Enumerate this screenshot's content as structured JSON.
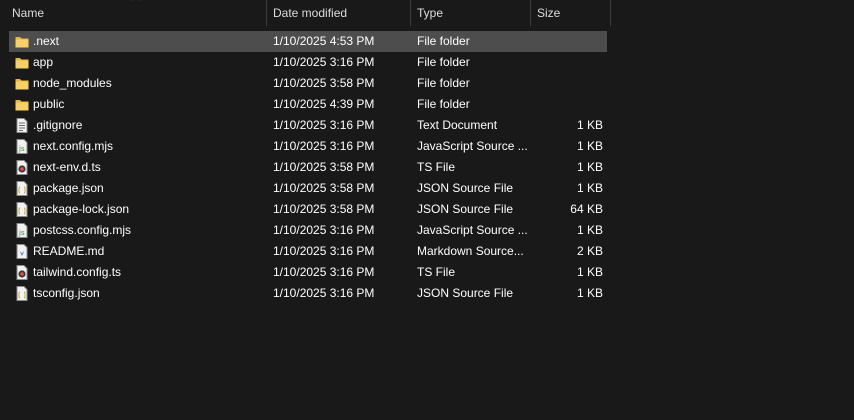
{
  "columns": {
    "name": "Name",
    "date": "Date modified",
    "type": "Type",
    "size": "Size"
  },
  "files": [
    {
      "name": ".next",
      "date": "1/10/2025 4:53 PM",
      "type": "File folder",
      "size": "",
      "icon": "folder-icon",
      "selected": true
    },
    {
      "name": "app",
      "date": "1/10/2025 3:16 PM",
      "type": "File folder",
      "size": "",
      "icon": "folder-icon",
      "selected": false
    },
    {
      "name": "node_modules",
      "date": "1/10/2025 3:58 PM",
      "type": "File folder",
      "size": "",
      "icon": "folder-icon",
      "selected": false
    },
    {
      "name": "public",
      "date": "1/10/2025 4:39 PM",
      "type": "File folder",
      "size": "",
      "icon": "folder-icon",
      "selected": false
    },
    {
      "name": ".gitignore",
      "date": "1/10/2025 3:16 PM",
      "type": "Text Document",
      "size": "1 KB",
      "icon": "text-document-icon",
      "selected": false
    },
    {
      "name": "next.config.mjs",
      "date": "1/10/2025 3:16 PM",
      "type": "JavaScript Source ...",
      "size": "1 KB",
      "icon": "javascript-file-icon",
      "selected": false
    },
    {
      "name": "next-env.d.ts",
      "date": "1/10/2025 3:58 PM",
      "type": "TS File",
      "size": "1 KB",
      "icon": "ts-file-icon",
      "selected": false
    },
    {
      "name": "package.json",
      "date": "1/10/2025 3:58 PM",
      "type": "JSON Source File",
      "size": "1 KB",
      "icon": "json-file-icon",
      "selected": false
    },
    {
      "name": "package-lock.json",
      "date": "1/10/2025 3:58 PM",
      "type": "JSON Source File",
      "size": "64 KB",
      "icon": "json-file-icon",
      "selected": false
    },
    {
      "name": "postcss.config.mjs",
      "date": "1/10/2025 3:16 PM",
      "type": "JavaScript Source ...",
      "size": "1 KB",
      "icon": "javascript-file-icon",
      "selected": false
    },
    {
      "name": "README.md",
      "date": "1/10/2025 3:16 PM",
      "type": "Markdown Source...",
      "size": "2 KB",
      "icon": "markdown-file-icon",
      "selected": false
    },
    {
      "name": "tailwind.config.ts",
      "date": "1/10/2025 3:16 PM",
      "type": "TS File",
      "size": "1 KB",
      "icon": "ts-file-icon",
      "selected": false
    },
    {
      "name": "tsconfig.json",
      "date": "1/10/2025 3:16 PM",
      "type": "JSON Source File",
      "size": "1 KB",
      "icon": "json-file-icon",
      "selected": false
    }
  ],
  "colors": {
    "background": "#191919",
    "selected_row": "#4d4d4d",
    "folder": "#f3c74f",
    "text": "#ffffff"
  }
}
